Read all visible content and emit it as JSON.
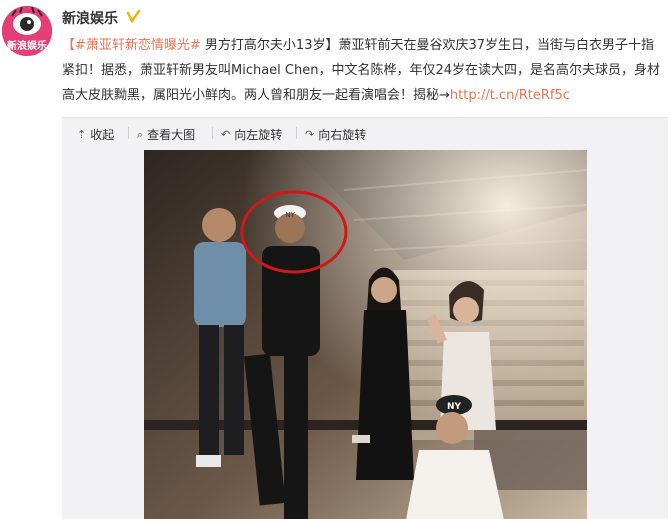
{
  "header": {
    "account_name": "新浪娱乐",
    "avatar_text": "新浪娱乐",
    "verified_icon": "verified-badge-icon"
  },
  "post": {
    "topic": "【#萧亚轩新恋情曝光#",
    "headline": " 男方打高尔夫小13岁】",
    "body": "萧亚轩前天在曼谷欢庆37岁生日，当街与白衣男子十指紧扣！据悉，萧亚轩新男友叫Michael Chen，中文名陈桦，年仅24岁在读大四，是名高尔夫球员，身材高大皮肤黝黑，属阳光小鲜肉。两人曾和朋友一起看演唱会！揭秘→",
    "link": "http://t.cn/RteRf5c"
  },
  "toolbar": {
    "collapse": {
      "label": "收起",
      "icon": "arrow-up-icon"
    },
    "view_large": {
      "label": "查看大图",
      "icon": "magnifier-icon"
    },
    "rotate_left": {
      "label": "向左旋转",
      "icon": "rotate-left-icon"
    },
    "rotate_right": {
      "label": "向右旋转",
      "icon": "rotate-right-icon"
    }
  },
  "photo": {
    "description_icon": "concert-group-photo",
    "cap_text": "NY",
    "highlight_color": "#d01818"
  },
  "colors": {
    "accent": "#eb7350",
    "avatar_bg": "#e63d77",
    "toolbar_bg": "#f2f2f5"
  }
}
